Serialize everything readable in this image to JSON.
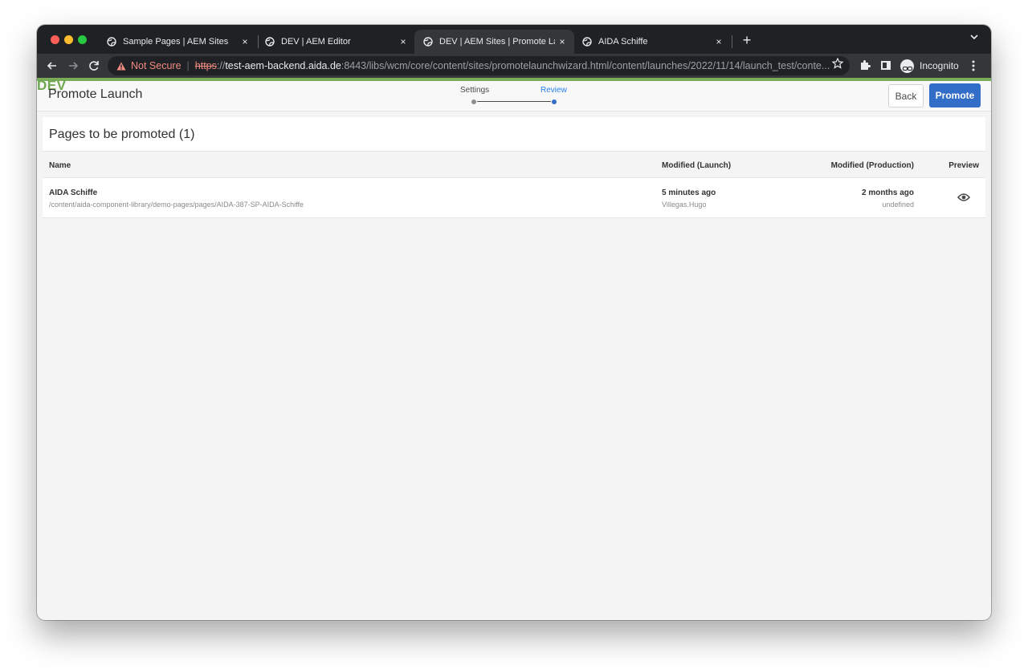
{
  "browser": {
    "tabs": [
      {
        "title": "Sample Pages | AEM Sites",
        "active": false
      },
      {
        "title": "DEV | AEM Editor",
        "active": false
      },
      {
        "title": "DEV | AEM Sites | Promote Laun",
        "active": true
      },
      {
        "title": "AIDA Schiffe",
        "active": false
      }
    ],
    "close_glyph": "×",
    "new_tab_glyph": "+",
    "address": {
      "warning_icon": "warning-icon",
      "not_secure": "Not Secure",
      "separator": "|",
      "scheme": "https",
      "scheme_sep": "://",
      "host": "test-aem-backend.aida.de",
      "rest": ":8443/libs/wcm/core/content/sites/promotelaunchwizard.html/content/launches/2022/11/14/launch_test/conte..."
    },
    "incognito_label": "Incognito"
  },
  "env": {
    "label": "DEV",
    "color": "#7aab58"
  },
  "header": {
    "title": "Promote Launch",
    "steps": [
      {
        "label": "Settings",
        "state": "done"
      },
      {
        "label": "Review",
        "state": "current"
      }
    ],
    "back_label": "Back",
    "promote_label": "Promote"
  },
  "content": {
    "section_title": "Pages to be promoted (1)",
    "columns": {
      "name": "Name",
      "modified_launch": "Modified (Launch)",
      "modified_production": "Modified (Production)",
      "preview": "Preview"
    },
    "rows": [
      {
        "name": "AIDA Schiffe",
        "path": "/content/aida-component-library/demo-pages/pages/AIDA-387-SP-AIDA-Schiffe",
        "launch_modified": "5 minutes ago",
        "launch_by": "Villegas.Hugo",
        "production_modified": "2 months ago",
        "production_by": "undefined"
      }
    ]
  },
  "colors": {
    "accent": "#326ec8",
    "stepper_active": "#2680eb"
  }
}
